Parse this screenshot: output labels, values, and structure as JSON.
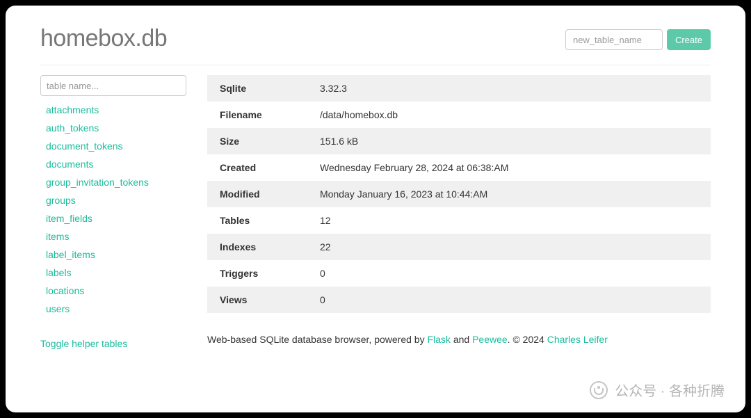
{
  "title": "homebox.db",
  "create": {
    "placeholder": "new_table_name",
    "button_label": "Create"
  },
  "filter": {
    "placeholder": "table name..."
  },
  "tables": [
    "attachments",
    "auth_tokens",
    "document_tokens",
    "documents",
    "group_invitation_tokens",
    "groups",
    "item_fields",
    "items",
    "label_items",
    "labels",
    "locations",
    "users"
  ],
  "toggle_label": "Toggle helper tables",
  "info_rows": [
    {
      "label": "Sqlite",
      "value": "3.32.3"
    },
    {
      "label": "Filename",
      "value": "/data/homebox.db"
    },
    {
      "label": "Size",
      "value": "151.6 kB"
    },
    {
      "label": "Created",
      "value": "Wednesday February 28, 2024 at 06:38:AM"
    },
    {
      "label": "Modified",
      "value": "Monday January 16, 2023 at 10:44:AM"
    },
    {
      "label": "Tables",
      "value": "12"
    },
    {
      "label": "Indexes",
      "value": "22"
    },
    {
      "label": "Triggers",
      "value": "0"
    },
    {
      "label": "Views",
      "value": "0"
    }
  ],
  "footer": {
    "prefix": "Web-based SQLite database browser, powered by ",
    "flask": "Flask",
    "and": " and ",
    "peewee": "Peewee",
    "copyright": ". © 2024 ",
    "author": "Charles Leifer"
  },
  "watermark": "公众号 · 各种折腾"
}
